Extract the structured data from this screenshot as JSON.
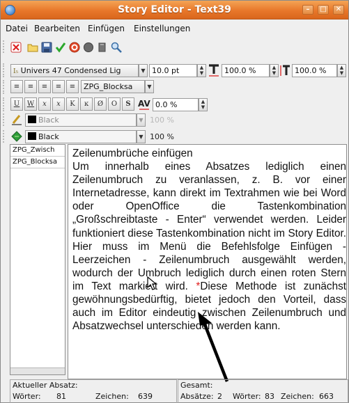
{
  "window": {
    "title": "Story Editor - Text39",
    "minimize_glyph": "–",
    "maximize_glyph": "□",
    "close_glyph": "✕"
  },
  "menu": {
    "items": [
      "Datei",
      "Bearbeiten",
      "Einfügen",
      "Einstellungen"
    ]
  },
  "toolbar_main": {
    "icons": [
      "clear-icon",
      "open-icon",
      "save-icon",
      "apply-checkmark-icon",
      "reload-icon",
      "record-icon",
      "book-icon",
      "search-replace-icon"
    ]
  },
  "font_row": {
    "font_name": "Univers 47 Condensed Lig",
    "font_size": "10.0 pt",
    "scale_h": "100.0 %",
    "scale_v": "100.0 %"
  },
  "paragraph_row": {
    "paragraph_style": "ZPG_Blocksa"
  },
  "effects_row": {
    "buttons": [
      "U",
      "W",
      "x",
      "x",
      "K",
      "ĸ",
      "Ø",
      "O",
      "S"
    ],
    "tracking": "0.0 %"
  },
  "stroke_row": {
    "color_name": "Black",
    "shade": "100 %"
  },
  "fill_row": {
    "color_name": "Black",
    "shade": "100 %"
  },
  "style_list": {
    "items": [
      "ZPG_Zwisch",
      "ZPG_Blocksa"
    ]
  },
  "editor": {
    "heading": "Zeilenumbrüche einfügen",
    "body_before_marker": "Um innerhalb eines Absatzes lediglich einen Zeilenumbruch zu veranlassen, z. B. vor einer Internetadresse, kann direkt im Textrahmen wie bei Word oder OpenOffice die Tastenkombination „Großschreibtaste - Enter“ verwendet werden. Leider funktioniert diese Tastenkombination nicht im Story Editor. Hier muss im Menü die Befehlsfolge Einfügen - Leerzeichen - Zeilenumbruch ausgewählt werden, wodurch der Umbruch lediglich durch einen roten Stern im Text markiert wird. ",
    "marker": "*",
    "body_after_marker": "Diese Methode ist zunächst gewöhnungsbedürftig, bietet jedoch den Vorteil, dass auch im Editor eindeutig zwischen Zeilenumbruch und Absatzwechsel unterschieden werden kann.",
    "marker_color": "#e02020"
  },
  "status": {
    "current_label": "Aktueller Absatz:",
    "current_words_label": "Wörter:",
    "current_words": "81",
    "current_chars_label": "Zeichen:",
    "current_chars": "639",
    "total_label": "Gesamt:",
    "total_paragraphs_label": "Absätze:",
    "total_paragraphs": "2",
    "total_words_label": "Wörter:",
    "total_words": "83",
    "total_chars_label": "Zeichen:",
    "total_chars": "663"
  }
}
